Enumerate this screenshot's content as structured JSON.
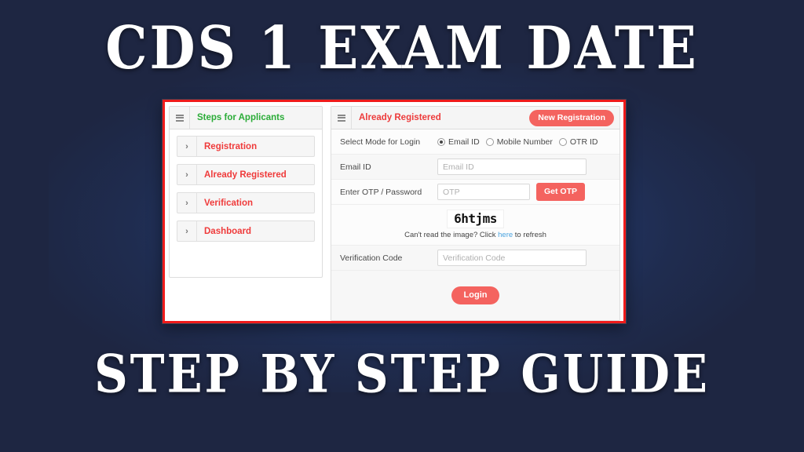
{
  "headline": {
    "top": "CDS 1  EXAM DATE",
    "bottom": "STEP BY STEP GUIDE"
  },
  "colors": {
    "background": "#1e2642",
    "glow": "#2a4a85",
    "border_accent": "#ef1b1b",
    "brand_red": "#f4635f",
    "link_red": "#ef3b3b",
    "link_green": "#2bac38",
    "link_blue": "#4aa3df"
  },
  "left_panel": {
    "menu_icon": "hamburger-icon",
    "title": "Steps for Applicants",
    "items": [
      {
        "chevron": "chevron-right-icon",
        "label": "Registration"
      },
      {
        "chevron": "chevron-right-icon",
        "label": "Already Registered"
      },
      {
        "chevron": "chevron-right-icon",
        "label": "Verification"
      },
      {
        "chevron": "chevron-right-icon",
        "label": "Dashboard"
      }
    ]
  },
  "right_panel": {
    "menu_icon": "hamburger-icon",
    "title": "Already Registered",
    "new_registration_label": "New Registration",
    "mode_row": {
      "label": "Select Mode for Login",
      "options": [
        {
          "label": "Email ID",
          "selected": true
        },
        {
          "label": "Mobile Number",
          "selected": false
        },
        {
          "label": "OTR ID",
          "selected": false
        }
      ]
    },
    "email_row": {
      "label": "Email ID",
      "placeholder": "Email ID",
      "value": ""
    },
    "otp_row": {
      "label": "Enter OTP / Password",
      "placeholder": "OTP",
      "value": "",
      "button_label": "Get OTP"
    },
    "captcha": {
      "code": "6htjms",
      "hint_prefix": "Can't read the image? Click ",
      "hint_link": "here",
      "hint_suffix": " to refresh"
    },
    "verification_row": {
      "label": "Verification Code",
      "placeholder": "Verification Code",
      "value": ""
    },
    "login_label": "Login"
  }
}
